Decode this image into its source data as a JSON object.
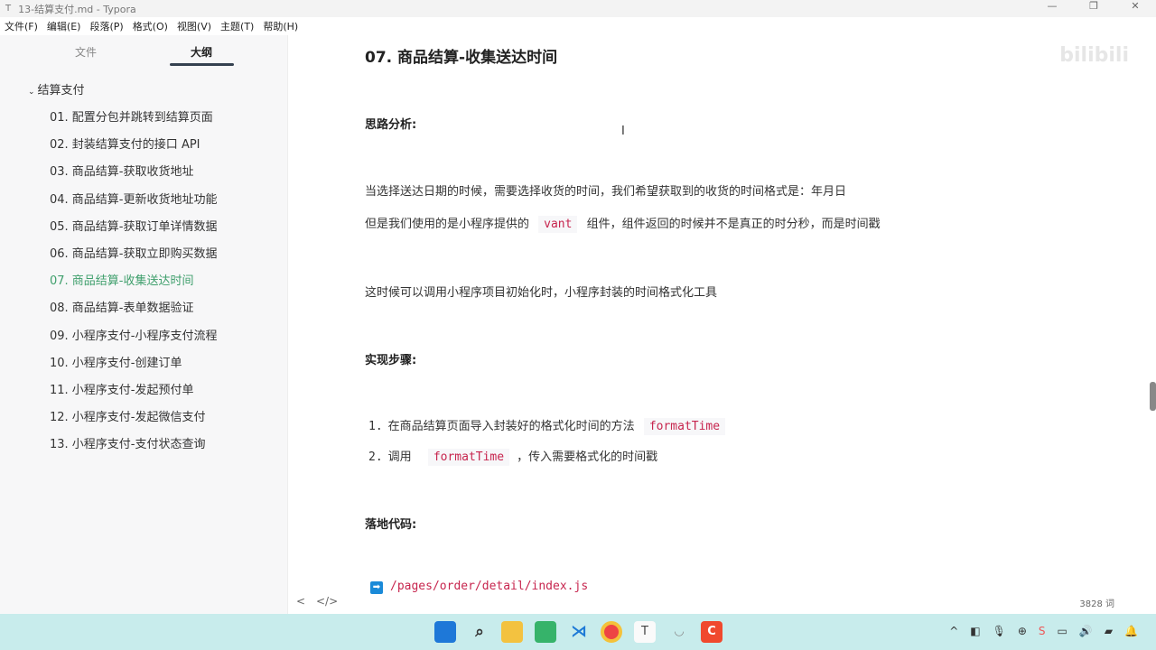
{
  "window": {
    "icon": "T",
    "title": "13-结算支付.md - Typora",
    "min": "—",
    "max": "❐",
    "close": "✕"
  },
  "menu": [
    "文件(F)",
    "编辑(E)",
    "段落(P)",
    "格式(O)",
    "视图(V)",
    "主题(T)",
    "帮助(H)"
  ],
  "sidebar": {
    "tabs": [
      "文件",
      "大纲"
    ],
    "root": "结算支付",
    "items": [
      "01. 配置分包并跳转到结算页面",
      "02. 封装结算支付的接口 API",
      "03. 商品结算-获取收货地址",
      "04. 商品结算-更新收货地址功能",
      "05. 商品结算-获取订单详情数据",
      "06. 商品结算-获取立即购买数据",
      "07. 商品结算-收集送达时间",
      "08. 商品结算-表单数据验证",
      "09. 小程序支付-小程序支付流程",
      "10. 小程序支付-创建订单",
      "11. 小程序支付-发起预付单",
      "12. 小程序支付-发起微信支付",
      "13. 小程序支付-支付状态查询"
    ],
    "active_index": 6
  },
  "doc": {
    "heading": "07. 商品结算-收集送达时间",
    "analysis_label": "思路分析:",
    "p1": "当选择送达日期的时候，需要选择收货的时间，我们希望获取到的收货的时间格式是：年月日",
    "p2a": "但是我们使用的是小程序提供的",
    "p2code": "vant",
    "p2b": "组件，组件返回的时候并不是真正的时分秒，而是时间戳",
    "p3": "这时候可以调用小程序项目初始化时，小程序封装的时间格式化工具",
    "steps_label": "实现步骤:",
    "steps": [
      {
        "n": "1.",
        "a": "在商品结算页面导入封装好的格式化时间的方法",
        "code": "formatTime",
        "b": ""
      },
      {
        "n": "2.",
        "a": "调用",
        "code": "formatTime",
        "b": "，传入需要格式化的时间戳"
      }
    ],
    "code_label": "落地代码:",
    "path": "/pages/order/detail/index.js"
  },
  "footer": {
    "back": "<",
    "source": "</>",
    "word_count": "3828 词"
  },
  "watermark": "bilibili",
  "taskbar": {
    "icons": [
      "windows-start",
      "search",
      "file-explorer",
      "wechat-devtools",
      "vscode",
      "chrome",
      "typora",
      "app",
      "recorder"
    ],
    "tray": [
      "^",
      "◧",
      "🎙",
      "⊕",
      "S",
      "▭",
      "🔊",
      "▰",
      "🔔"
    ]
  }
}
